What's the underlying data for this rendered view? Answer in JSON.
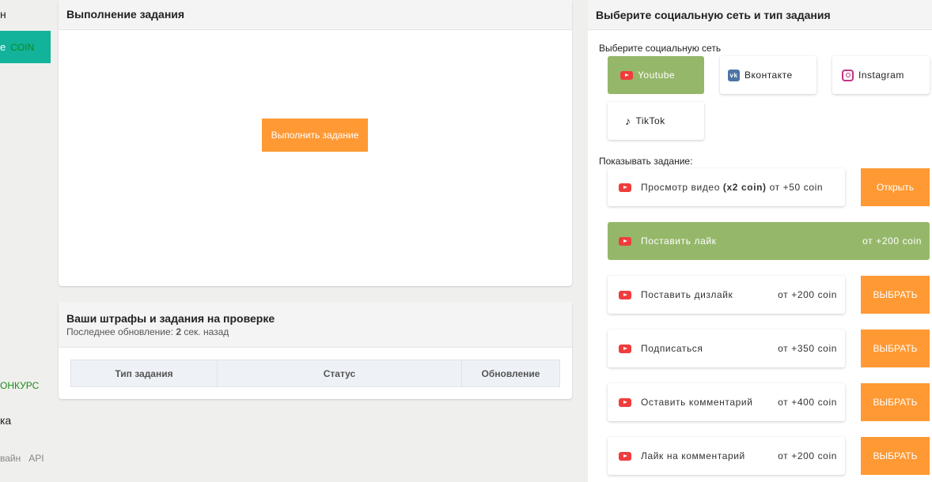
{
  "sidebar": {
    "top_fragment": "н",
    "coin_button": {
      "prefix": "е",
      "label": "COIN"
    },
    "contest": "ОНКУРС",
    "item": "ка",
    "footer": [
      "вайн",
      "API"
    ]
  },
  "execution": {
    "title": "Выполнение задания",
    "button": "Выполнить задание"
  },
  "fines": {
    "title": "Ваши штрафы и задания на проверке",
    "updated_prefix": "Последнее обновление:",
    "updated_value": "2",
    "updated_suffix": "сек. назад",
    "columns": [
      "Тип задания",
      "Статус",
      "Обновление"
    ]
  },
  "networks": {
    "title": "Выберите социальную сеть и тип задания",
    "label": "Выберите социальную сеть",
    "items": [
      {
        "name": "Youtube",
        "icon": "youtube-icon",
        "selected": true
      },
      {
        "name": "Вконтакте",
        "icon": "vk-icon"
      },
      {
        "name": "Instagram",
        "icon": "instagram-icon"
      },
      {
        "name": "TikTok",
        "icon": "tiktok-icon"
      }
    ]
  },
  "tasks": {
    "label": "Показывать задание:",
    "items": [
      {
        "name": "Просмотр видео",
        "bold": "(x2 coin)",
        "reward": "от +50 coin",
        "button": "Открыть"
      },
      {
        "name": "Поставить лайк",
        "reward": "от +200 coin",
        "selected": true
      },
      {
        "name": "Поставить дизлайк",
        "reward": "от +200 coin",
        "button": "ВЫБРАТЬ"
      },
      {
        "name": "Подписаться",
        "reward": "от +350 coin",
        "button": "ВЫБРАТЬ"
      },
      {
        "name": "Оставить комментарий",
        "reward": "от +400 coin",
        "button": "ВЫБРАТЬ"
      },
      {
        "name": "Лайк на комментарий",
        "reward": "от +200 coin",
        "button": "ВЫБРАТЬ"
      }
    ]
  },
  "colors": {
    "accent_orange": "#ff9933",
    "selected_green": "#95b76a",
    "coin_teal": "#13b29a"
  }
}
